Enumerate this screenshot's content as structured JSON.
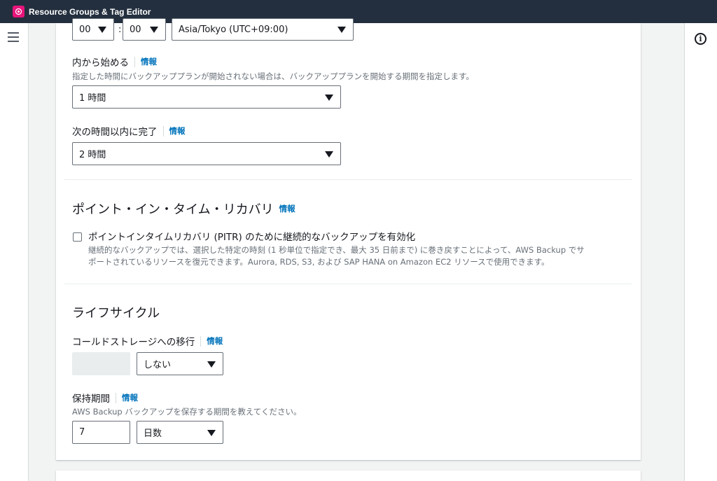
{
  "app": {
    "title": "Resource Groups & Tag Editor"
  },
  "time": {
    "hour": "00",
    "minute": "00",
    "colon": ":",
    "timezone": "Asia/Tokyo (UTC+09:00)"
  },
  "start_within": {
    "label": "内から始める",
    "info": "情報",
    "description": "指定した時間にバックアッププランが開始されない場合は、バックアッププランを開始する期間を指定します。",
    "value": "1 時間"
  },
  "complete_within": {
    "label": "次の時間以内に完了",
    "info": "情報",
    "value": "2 時間"
  },
  "pitr": {
    "heading": "ポイント・イン・タイム・リカバリ",
    "info": "情報",
    "checkbox_label": "ポイントインタイムリカバリ (PITR) のために継続的なバックアップを有効化",
    "checked": false,
    "description_line1": "継続的なバックアップでは、選択した特定の時刻 (1 秒単位で指定でき、最大 35 日前まで) に巻き戻すことによって、AWS Backup でサ",
    "description_line2": "ポートされているリソースを復元できます。Aurora, RDS, S3, および SAP HANA on Amazon EC2 リソースで使用できます。"
  },
  "lifecycle": {
    "heading": "ライフサイクル",
    "cold_storage": {
      "label": "コールドストレージへの移行",
      "info": "情報",
      "value": "しない"
    },
    "retention": {
      "label": "保持期間",
      "info": "情報",
      "description": "AWS Backup バックアップを保存する期間を教えてください。",
      "value": "7",
      "unit": "日数"
    }
  },
  "colors": {
    "topbar": "#232f3e",
    "link": "#0073bb",
    "brand": "#e7157b"
  }
}
